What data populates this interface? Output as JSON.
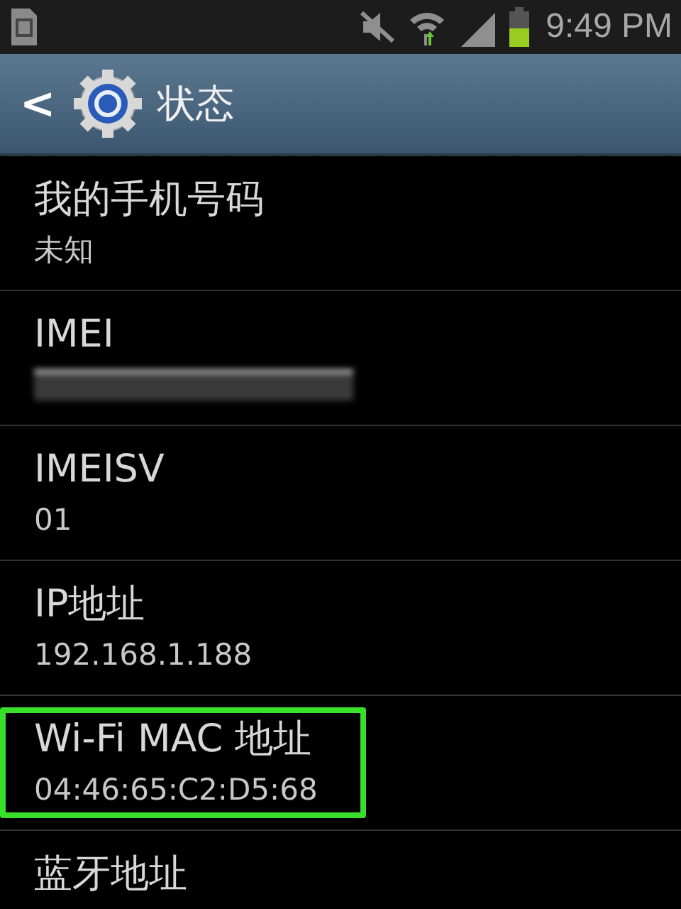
{
  "status_bar": {
    "time": "9:49 PM"
  },
  "action_bar": {
    "back": "<",
    "title": "状态"
  },
  "items": [
    {
      "kind": "text",
      "title": "我的手机号码",
      "value": "未知",
      "highlighted": false
    },
    {
      "kind": "redacted",
      "title": "IMEI",
      "highlighted": false
    },
    {
      "kind": "text",
      "title": "IMEISV",
      "value": "01",
      "highlighted": false
    },
    {
      "kind": "text",
      "title": "IP地址",
      "value": "192.168.1.188",
      "highlighted": false
    },
    {
      "kind": "text",
      "title": "Wi-Fi MAC 地址",
      "value": "04:46:65:C2:D5:68",
      "highlighted": true
    },
    {
      "kind": "title",
      "title": "蓝牙地址",
      "highlighted": false
    }
  ]
}
